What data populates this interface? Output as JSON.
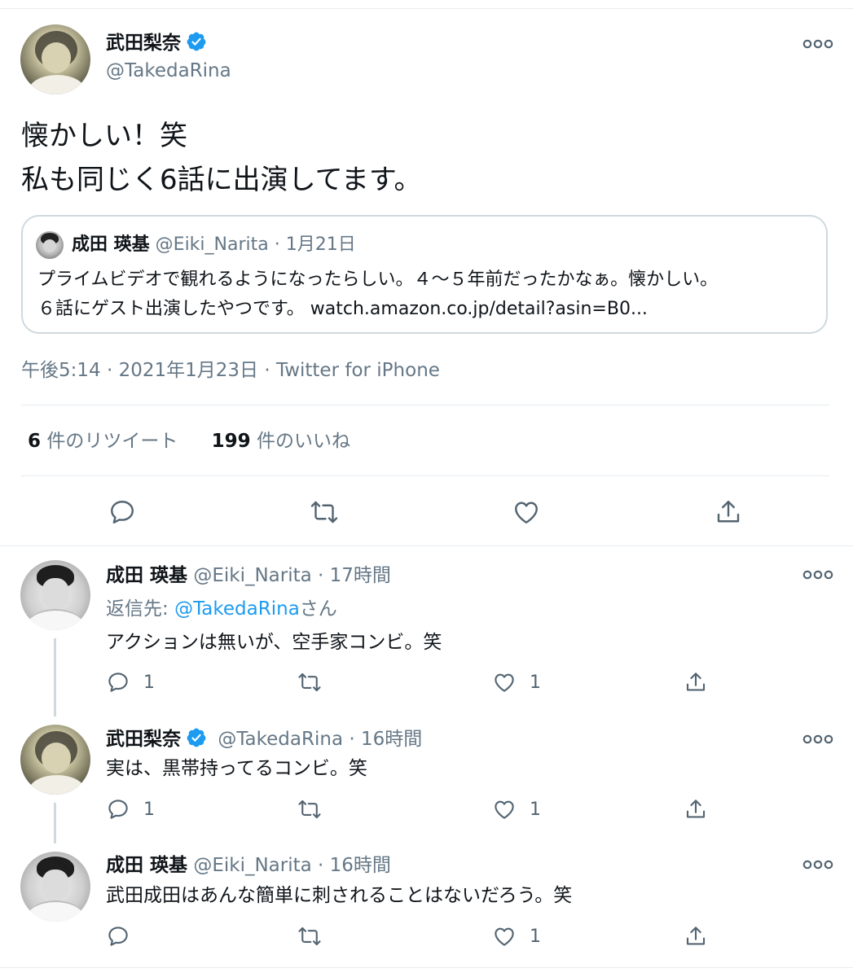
{
  "main": {
    "author_name": "武田梨奈",
    "author_handle": "@TakedaRina",
    "text_line1": "懐かしい！笑",
    "text_line2": "私も同じく6話に出演してます。",
    "quote": {
      "name": "成田 瑛基",
      "handle": "@Eiki_Narita",
      "date": "· 1月21日",
      "line1": "プライムビデオで観れるようになったらしい。４〜５年前だったかなぁ。懐かしい。",
      "line2": "６話にゲスト出演したやつです。 watch.amazon.co.jp/detail?asin=B0..."
    },
    "meta": "午後5:14 · 2021年1月23日 · Twitter for iPhone",
    "retweet_count": "6",
    "retweet_label": "件のリツイート",
    "like_count": "199",
    "like_label": "件のいいね"
  },
  "replies": [
    {
      "name": "成田 瑛基",
      "handle": "@Eiki_Narita",
      "time": "· 17時間",
      "reply_to_prefix": "返信先: ",
      "reply_to_handle": "@TakedaRina",
      "reply_to_suffix": "さん",
      "text": "アクションは無いが、空手家コンビ。笑",
      "reply_count": "1",
      "like_count": "1"
    },
    {
      "name": "武田梨奈",
      "handle": "@TakedaRina",
      "time": "· 16時間",
      "text": "実は、黒帯持ってるコンビ。笑",
      "reply_count": "1",
      "like_count": "1"
    },
    {
      "name": "成田 瑛基",
      "handle": "@Eiki_Narita",
      "time": "· 16時間",
      "text": "武田成田はあんな簡単に刺されることはないだろう。笑",
      "reply_count": "",
      "like_count": "1"
    }
  ],
  "icons": [
    "verified-icon",
    "more-icon",
    "reply-icon",
    "retweet-icon",
    "like-icon",
    "share-icon"
  ],
  "colors": {
    "accent": "#1d9bf0",
    "gray": "#657786",
    "divider": "#e6ecf0"
  }
}
